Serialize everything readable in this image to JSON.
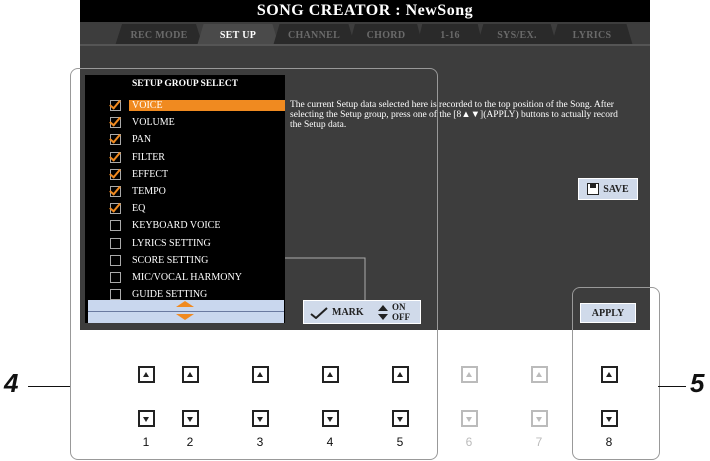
{
  "title": "SONG CREATOR : NewSong",
  "tabs": [
    {
      "label": "REC MODE"
    },
    {
      "label": "SET UP"
    },
    {
      "label": "CHANNEL"
    },
    {
      "label": "CHORD"
    },
    {
      "label": "1-16"
    },
    {
      "label": "SYS/EX."
    },
    {
      "label": "LYRICS"
    }
  ],
  "active_tab": "SET UP",
  "setup_group": {
    "title": "SETUP GROUP SELECT",
    "items": [
      {
        "label": "VOICE",
        "checked": true,
        "selected": true
      },
      {
        "label": "VOLUME",
        "checked": true
      },
      {
        "label": "PAN",
        "checked": true
      },
      {
        "label": "FILTER",
        "checked": true
      },
      {
        "label": "EFFECT",
        "checked": true
      },
      {
        "label": "TEMPO",
        "checked": true
      },
      {
        "label": "EQ",
        "checked": true
      },
      {
        "label": "KEYBOARD VOICE",
        "checked": false
      },
      {
        "label": "LYRICS SETTING",
        "checked": false
      },
      {
        "label": "SCORE SETTING",
        "checked": false
      },
      {
        "label": "MIC/VOCAL HARMONY",
        "checked": false
      },
      {
        "label": "GUIDE SETTING",
        "checked": false
      }
    ]
  },
  "description": "The current Setup data selected here is recorded to the top position of the Song. After selecting the Setup group, press one of the [8▲▼](APPLY) buttons to actually record the Setup data.",
  "mark_button": {
    "mark_label": "MARK",
    "on_label": "ON",
    "off_label": "OFF"
  },
  "save_label": "SAVE",
  "apply_label": "APPLY",
  "button_numbers": [
    "1",
    "2",
    "3",
    "4",
    "5",
    "6",
    "7",
    "8"
  ],
  "callouts": {
    "left": "4",
    "right": "5"
  },
  "colors": {
    "accent": "#f08a20",
    "screen_bg": "#3d3d3d",
    "button_bg": "#d0daea"
  }
}
